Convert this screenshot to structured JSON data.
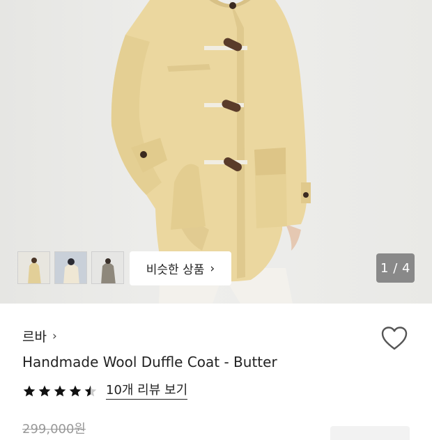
{
  "gallery": {
    "similar_label": "비슷한 상품",
    "similar_chevron": "›",
    "pager": "1 / 4",
    "colors": {
      "coat": "#ebd79f",
      "coat_shadow": "#d7c083",
      "toggle": "#5a3b2a",
      "rope": "#f1ede2",
      "pants": "#f3f1ec"
    }
  },
  "product": {
    "brand": "르바",
    "brand_chevron": "›",
    "title": "Handmade Wool Duffle Coat - Butter",
    "rating": 4.5,
    "review_link": "10개 리뷰 보기",
    "original_price": "299,000원"
  },
  "icons": {
    "wishlist": "heart-outline-icon",
    "star": "star-icon"
  }
}
